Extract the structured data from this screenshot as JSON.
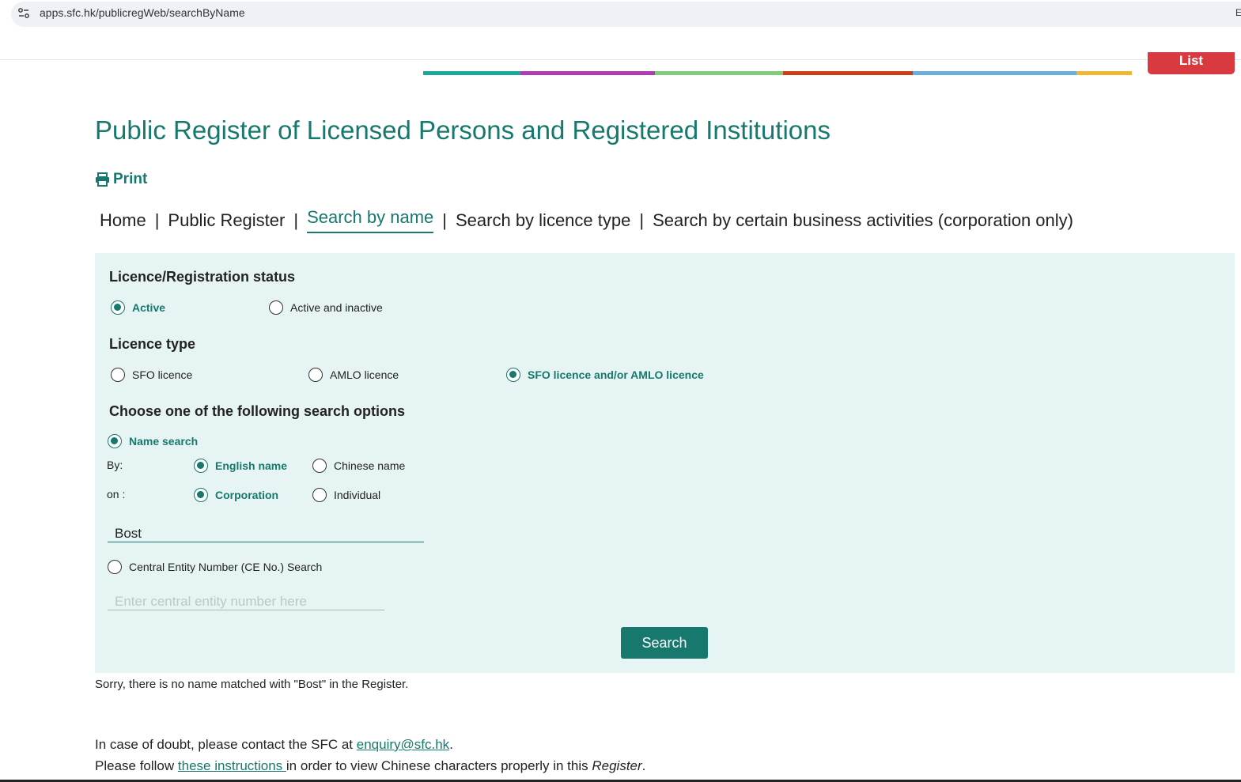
{
  "browser": {
    "url": "apps.sfc.hk/publicregWeb/searchByName",
    "site_icon": "tune-icon",
    "edge_glyph": "E"
  },
  "header": {
    "list_button": "List",
    "band_colors": [
      "#1aa89c",
      "#b03cb5",
      "#7fcc7a",
      "#cc3d1a",
      "#6aaedb",
      "#f2b630"
    ]
  },
  "page": {
    "title": "Public Register of Licensed Persons and Registered Institutions",
    "print_label": "Print"
  },
  "nav": {
    "items": [
      "Home",
      "Public Register",
      "Search by name",
      "Search by licence type",
      "Search by certain business activities (corporation only)"
    ],
    "active": "Search by name",
    "separator": "|"
  },
  "form": {
    "status": {
      "heading": "Licence/Registration status",
      "options": [
        "Active",
        "Active and inactive"
      ],
      "selected": "Active"
    },
    "licence_type": {
      "heading": "Licence type",
      "options": [
        "SFO licence",
        "AMLO licence",
        "SFO licence and/or AMLO licence"
      ],
      "selected": "SFO licence and/or AMLO licence"
    },
    "search_options": {
      "heading": "Choose one of the following search options",
      "name_search_label": "Name search",
      "by_label": "By:",
      "by_options": [
        "English name",
        "Chinese name"
      ],
      "by_selected": "English name",
      "on_label": "on :",
      "on_options": [
        "Corporation",
        "Individual"
      ],
      "on_selected": "Corporation",
      "name_value": "Bost",
      "ce_label": "Central Entity Number (CE No.) Search",
      "ce_placeholder": "Enter central entity number here",
      "selected": "Name search"
    },
    "search_button": "Search"
  },
  "result": {
    "message": "Sorry, there is no name matched with \"Bost\" in the Register."
  },
  "footer": {
    "line1_prefix": "In case of doubt, please contact the SFC at ",
    "email": "enquiry@sfc.hk",
    "line1_suffix": ".",
    "line2_prefix": "Please follow ",
    "instructions_link": "these instructions ",
    "line2_middle": "in order to view Chinese characters properly in this ",
    "register_word": "Register",
    "line2_suffix": "."
  },
  "colors": {
    "brand": "#17786e",
    "panel_bg": "#e6f5f3",
    "list_button": "#d93a3f"
  }
}
